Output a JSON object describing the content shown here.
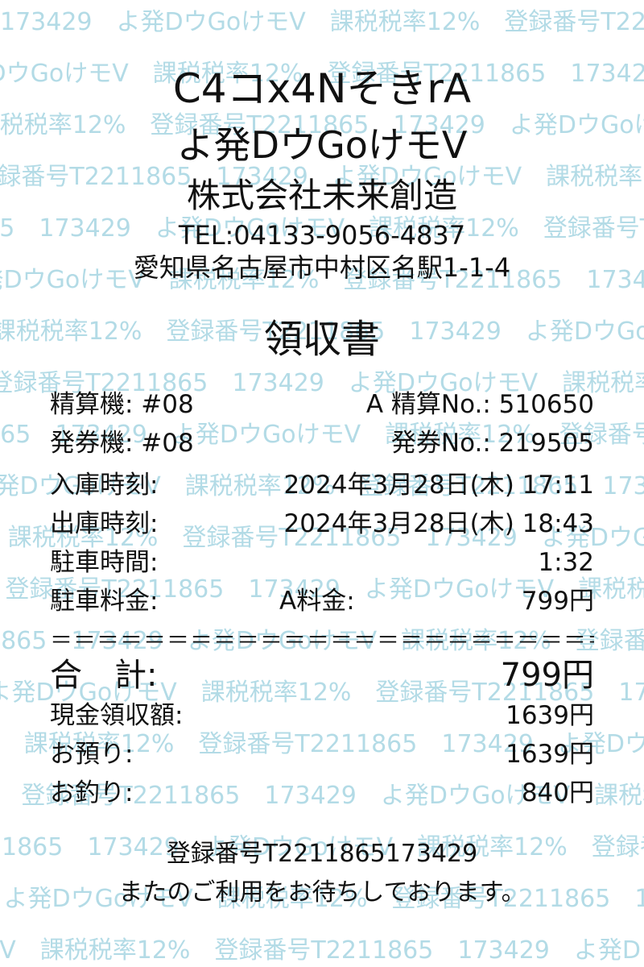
{
  "watermark_text": "173429　よ発DウGoけモV　課税税率12%　登録番号T2211865",
  "store": {
    "name": "C4コx4NそきrA",
    "sub_name": "よ発DウGoけモV",
    "company": "株式会社未来創造",
    "tel": "TEL:04133-9056-4837",
    "address": "愛知県名古屋市中村区名駅1-1-4"
  },
  "document_title": "領収書",
  "details": {
    "machine_label": "精算機: #08",
    "settle_no": "A 精算No.: 510650",
    "ticket_machine_label": "発券機: #08",
    "ticket_no": "発券No.: 219505",
    "entry_label": "入庫時刻:",
    "entry_time": "2024年3月28日(木) 17:11",
    "exit_label": "出庫時刻:",
    "exit_time": "2024年3月28日(木) 18:43",
    "duration_label": "駐車時間:",
    "duration": "1:32",
    "fee_label": "駐車料金:",
    "fee_type": "A料金:",
    "fee": "799円"
  },
  "divider": "＝＝＝＝＝＝＝＝＝＝＝＝＝＝＝＝＝＝＝＝＝＝＝＝＝＝＝＝＝",
  "totals": {
    "total_label": "合　計:",
    "total": "799円",
    "cash_label": "現金領収額:",
    "cash": "1639円",
    "deposit_label": "お預り:",
    "deposit": "1639円",
    "change_label": "お釣り:",
    "change": "840円"
  },
  "footer": {
    "registration": "登録番号T2211865173429",
    "thanks": "またのご利用をお待ちしております。"
  },
  "colors": {
    "watermark": "#b3dbe6",
    "text": "#111111",
    "background": "#ffffff"
  }
}
